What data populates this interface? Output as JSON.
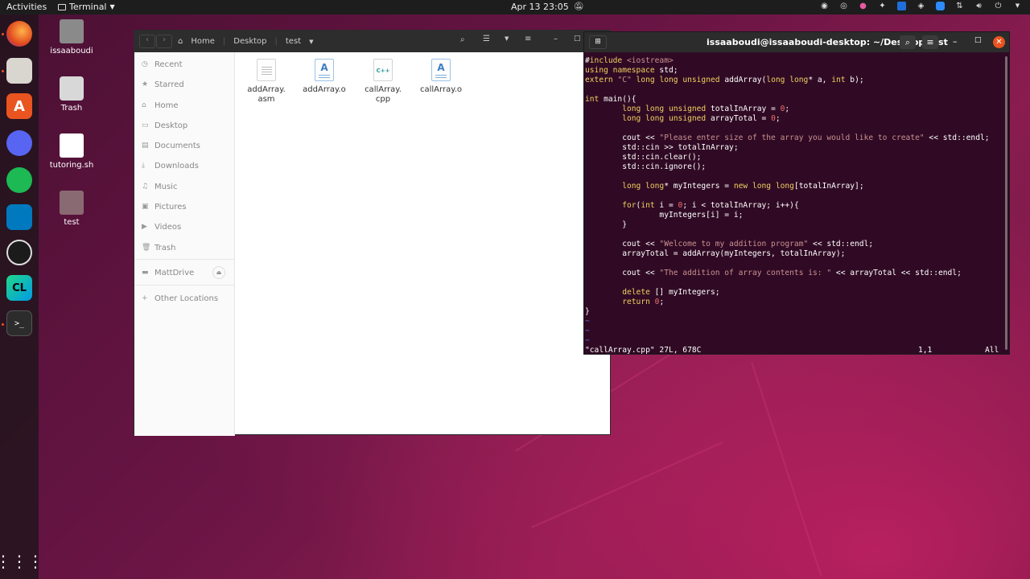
{
  "topbar": {
    "activities": "Activities",
    "app_menu": "Terminal",
    "clock": "Apr 13  23:05"
  },
  "desktop": {
    "icons": [
      {
        "label": "issaaboudi"
      },
      {
        "label": "Trash"
      },
      {
        "label": "tutoring.sh"
      },
      {
        "label": "test"
      }
    ]
  },
  "files": {
    "nav": {
      "home": "Home",
      "desktop": "Desktop",
      "current": "test"
    },
    "sidebar": [
      "Recent",
      "Starred",
      "Home",
      "Desktop",
      "Documents",
      "Downloads",
      "Music",
      "Pictures",
      "Videos",
      "Trash",
      "MattDrive",
      "Other Locations"
    ],
    "items": [
      {
        "name": "addArray.\nasm",
        "line1": "addArray.",
        "line2": "asm",
        "kind": "text"
      },
      {
        "name": "addArray.o",
        "line1": "addArray.o",
        "line2": "",
        "kind": "object"
      },
      {
        "name": "callArray.\ncpp",
        "line1": "callArray.",
        "line2": "cpp",
        "kind": "cpp",
        "badge": "C++"
      },
      {
        "name": "callArray.o",
        "line1": "callArray.o",
        "line2": "",
        "kind": "object"
      }
    ]
  },
  "terminal": {
    "title": "issaaboudi@issaaboudi-desktop: ~/Desktop/test",
    "status_left": "\"callArray.cpp\" 27L, 678C",
    "status_pos": "1,1",
    "status_right": "All",
    "lines": [
      "#include <iostream>",
      "using namespace std;",
      "extern \"C\" long long unsigned addArray(long long* a, int b);",
      "",
      "int main(){",
      "        long long unsigned totalInArray = 0;",
      "        long long unsigned arrayTotal = 0;",
      "",
      "        cout << \"Please enter size of the array you would like to create\" << std::endl;",
      "        std::cin >> totalInArray;",
      "        std::cin.clear();",
      "        std::cin.ignore();",
      "",
      "        long long* myIntegers = new long long[totalInArray];",
      "",
      "        for(int i = 0; i < totalInArray; i++){",
      "                myIntegers[i] = i;",
      "        }",
      "",
      "        cout << \"Welcome to my addition program\" << std::endl;",
      "        arrayTotal = addArray(myIntegers, totalInArray);",
      "",
      "        cout << \"The addition of array contents is: \" << arrayTotal << std::endl;",
      "",
      "        delete [] myIntegers;",
      "        return 0;",
      "}",
      "~",
      "~",
      "~"
    ]
  },
  "colors": {
    "terminal_bg": "#300a24",
    "keyword": "#f0d060",
    "string": "#c89090",
    "number": "#f07070",
    "accent": "#e95420"
  }
}
